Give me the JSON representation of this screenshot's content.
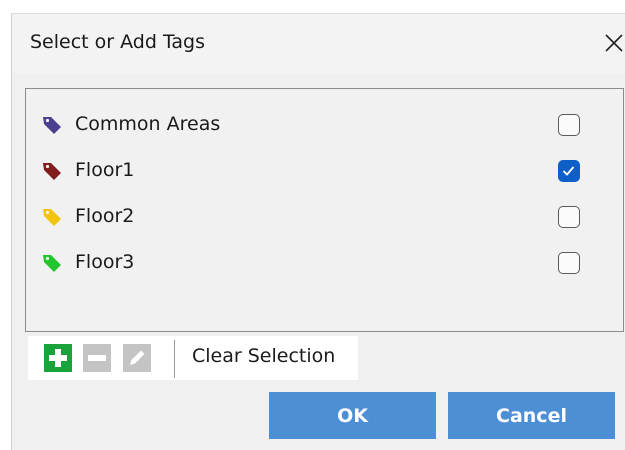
{
  "dialog": {
    "title": "Select or Add Tags",
    "close_icon": "close-icon"
  },
  "tags": [
    {
      "label": "Common Areas",
      "color": "#4b3f8f",
      "checked": false
    },
    {
      "label": "Floor1",
      "color": "#7f1d1d",
      "checked": true
    },
    {
      "label": "Floor2",
      "color": "#f2c40c",
      "checked": false
    },
    {
      "label": "Floor3",
      "color": "#22c52e",
      "checked": false
    }
  ],
  "toolbar": {
    "add_icon": "add-icon",
    "remove_icon": "remove-icon",
    "edit_icon": "edit-icon",
    "clear_label": "Clear Selection"
  },
  "buttons": {
    "ok_label": "OK",
    "cancel_label": "Cancel"
  },
  "colors": {
    "accent": "#4c8fd4",
    "check": "#0f5fc8",
    "add_green": "#1aa33a"
  }
}
